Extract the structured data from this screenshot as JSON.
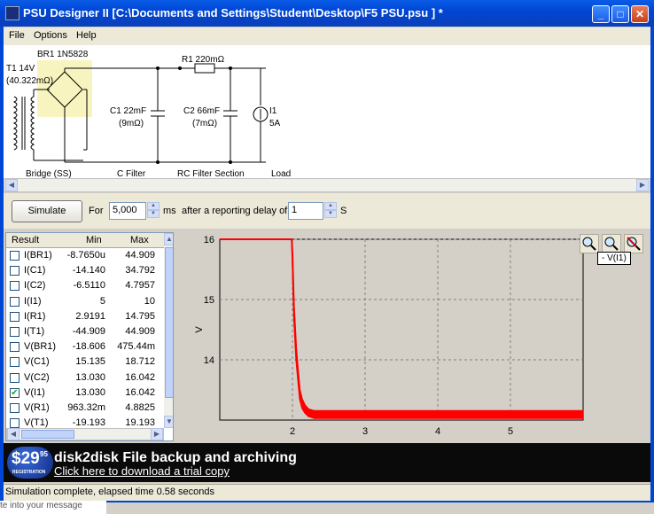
{
  "window": {
    "title": "PSU Designer II  [C:\\Documents and Settings\\Student\\Desktop\\F5 PSU.psu ] *",
    "min_icon": "minimize-icon",
    "max_icon": "maximize-icon",
    "close_icon": "close-icon"
  },
  "menu": [
    "File",
    "Options",
    "Help"
  ],
  "schematic": {
    "t1_label": "T1 14V",
    "t1_value": "(40.322mΩ)",
    "br1_label": "BR1 1N5828",
    "r1_label": "R1 220mΩ",
    "c1_label": "C1 22mF",
    "c1_esr": "(9mΩ)",
    "c2_label": "C2 66mF",
    "c2_esr": "(7mΩ)",
    "i1_label": "I1",
    "i1_value": "5A",
    "sections": [
      "Bridge (SS)",
      "C Filter",
      "RC Filter Section",
      "Load"
    ]
  },
  "toolbar": {
    "simulate_label": "Simulate",
    "for_label": "For",
    "duration_value": "5,000",
    "ms_label": "ms",
    "delay_label": "after a reporting delay of",
    "delay_value": "1",
    "s_label": "S"
  },
  "results": {
    "headers": [
      "Result",
      "Min",
      "Max"
    ],
    "rows": [
      {
        "name": "I(BR1)",
        "min": "-8.7650u",
        "max": "44.909",
        "checked": false
      },
      {
        "name": "I(C1)",
        "min": "-14.140",
        "max": "34.792",
        "checked": false
      },
      {
        "name": "I(C2)",
        "min": "-6.5110",
        "max": "4.7957",
        "checked": false
      },
      {
        "name": "I(I1)",
        "min": "5",
        "max": "10",
        "checked": false
      },
      {
        "name": "I(R1)",
        "min": "2.9191",
        "max": "14.795",
        "checked": false
      },
      {
        "name": "I(T1)",
        "min": "-44.909",
        "max": "44.909",
        "checked": false
      },
      {
        "name": "V(BR1)",
        "min": "-18.606",
        "max": "475.44m",
        "checked": false
      },
      {
        "name": "V(C1)",
        "min": "15.135",
        "max": "18.712",
        "checked": false
      },
      {
        "name": "V(C2)",
        "min": "13.030",
        "max": "16.042",
        "checked": false
      },
      {
        "name": "V(I1)",
        "min": "13.030",
        "max": "16.042",
        "checked": true
      },
      {
        "name": "V(R1)",
        "min": "963.32m",
        "max": "4.8825",
        "checked": false
      },
      {
        "name": "V(T1)",
        "min": "-19.193",
        "max": "19.193",
        "checked": false
      }
    ]
  },
  "plot": {
    "legend": "- V(I1)",
    "zoom_icons": [
      "zoom-in-icon",
      "zoom-fit-icon",
      "zoom-reset-icon"
    ],
    "series_color": "#ff0000"
  },
  "chart_data": {
    "type": "line",
    "ylabel": "V",
    "xlabel": "",
    "xticks": [
      "2",
      "3",
      "4",
      "5"
    ],
    "yticks": [
      "14",
      "15",
      "16"
    ],
    "xlim": [
      1.0,
      6.0
    ],
    "ylim": [
      13.0,
      16.0
    ],
    "grid": true,
    "series": [
      {
        "name": "V(I1)",
        "color": "#ff0000",
        "x": [
          1.0,
          1.99,
          2.0,
          2.02,
          2.05,
          2.08,
          2.1,
          2.13,
          2.17,
          2.22,
          2.3,
          6.0
        ],
        "y": [
          16.0,
          16.0,
          15.75,
          14.9,
          14.2,
          13.75,
          13.5,
          13.35,
          13.25,
          13.18,
          13.15,
          13.15
        ],
        "band": [
          16.0,
          16.0,
          15.6,
          14.7,
          14.0,
          13.6,
          13.35,
          13.2,
          13.12,
          13.06,
          13.03,
          13.03
        ]
      }
    ]
  },
  "ad": {
    "badge_price": "$29",
    "badge_cents": "95",
    "badge_note": "REGISTRATION",
    "title": "disk2disk File backup and archiving",
    "link": "Click here to download a trial copy"
  },
  "status": {
    "text": "Simulation complete, elapsed time 0.58 seconds"
  },
  "background_text": "te into your message"
}
